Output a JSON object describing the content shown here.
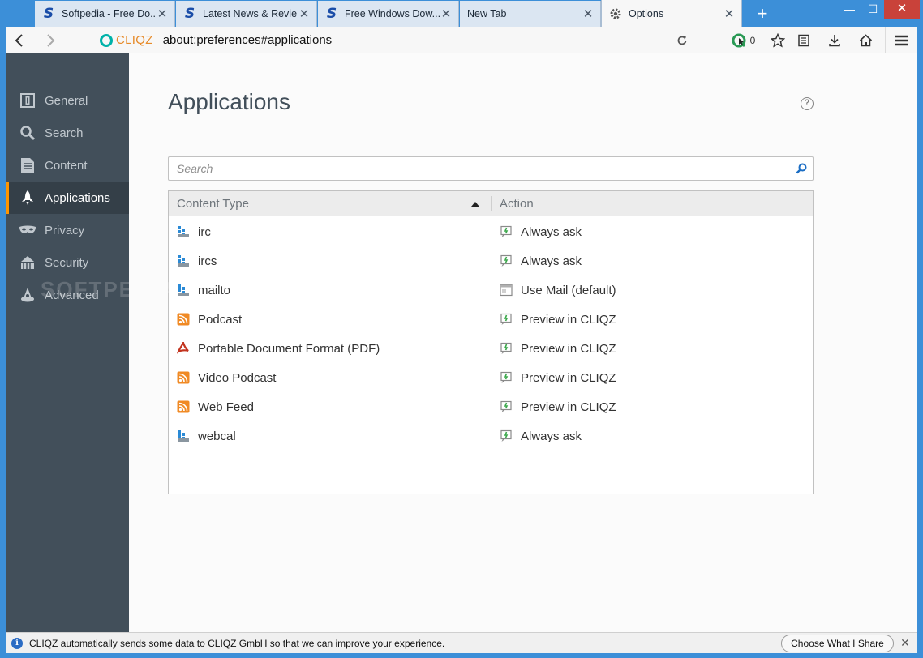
{
  "tabs": [
    {
      "title": "Softpedia - Free Do...",
      "icon": "softpedia-icon"
    },
    {
      "title": "Latest News & Revie...",
      "icon": "softpedia-icon"
    },
    {
      "title": "Free Windows Dow...",
      "icon": "softpedia-icon"
    },
    {
      "title": "New Tab",
      "icon": "none"
    },
    {
      "title": "Options",
      "icon": "gear-icon",
      "active": true
    }
  ],
  "window": {
    "minimize": "—",
    "maximize": "☐",
    "close": "✕",
    "new_tab": "+"
  },
  "nav": {
    "brand": "CLIQZ",
    "url": "about:preferences#applications",
    "counter": "0"
  },
  "sidebar": {
    "items": [
      {
        "label": "General",
        "icon": "general-icon"
      },
      {
        "label": "Search",
        "icon": "search-icon"
      },
      {
        "label": "Content",
        "icon": "content-icon"
      },
      {
        "label": "Applications",
        "icon": "rocket-icon",
        "active": true
      },
      {
        "label": "Privacy",
        "icon": "mask-icon"
      },
      {
        "label": "Security",
        "icon": "security-icon"
      },
      {
        "label": "Advanced",
        "icon": "wizard-icon"
      }
    ]
  },
  "main": {
    "title": "Applications",
    "help": "?",
    "search_placeholder": "Search",
    "columns": {
      "content_type": "Content Type",
      "action": "Action"
    },
    "rows": [
      {
        "type": "irc",
        "type_icon": "protocol-icon",
        "action": "Always ask",
        "action_icon": "ask-icon"
      },
      {
        "type": "ircs",
        "type_icon": "protocol-icon",
        "action": "Always ask",
        "action_icon": "ask-icon"
      },
      {
        "type": "mailto",
        "type_icon": "protocol-icon",
        "action": "Use Mail (default)",
        "action_icon": "app-icon"
      },
      {
        "type": "Podcast",
        "type_icon": "feed-icon",
        "action": "Preview in CLIQZ",
        "action_icon": "ask-icon"
      },
      {
        "type": "Portable Document Format (PDF)",
        "type_icon": "pdf-icon",
        "action": "Preview in CLIQZ",
        "action_icon": "ask-icon"
      },
      {
        "type": "Video Podcast",
        "type_icon": "feed-icon",
        "action": "Preview in CLIQZ",
        "action_icon": "ask-icon"
      },
      {
        "type": "Web Feed",
        "type_icon": "feed-icon",
        "action": "Preview in CLIQZ",
        "action_icon": "ask-icon"
      },
      {
        "type": "webcal",
        "type_icon": "protocol-icon",
        "action": "Always ask",
        "action_icon": "ask-icon"
      }
    ]
  },
  "status": {
    "message": "CLIQZ automatically sends some data to CLIQZ GmbH so that we can improve your experience.",
    "button": "Choose What I Share",
    "close": "✕"
  },
  "watermark": "SOFTPEDIA",
  "colors": {
    "accent": "#ff9500",
    "sidebar": "#424f5a",
    "titlebar": "#3c8fd8"
  }
}
